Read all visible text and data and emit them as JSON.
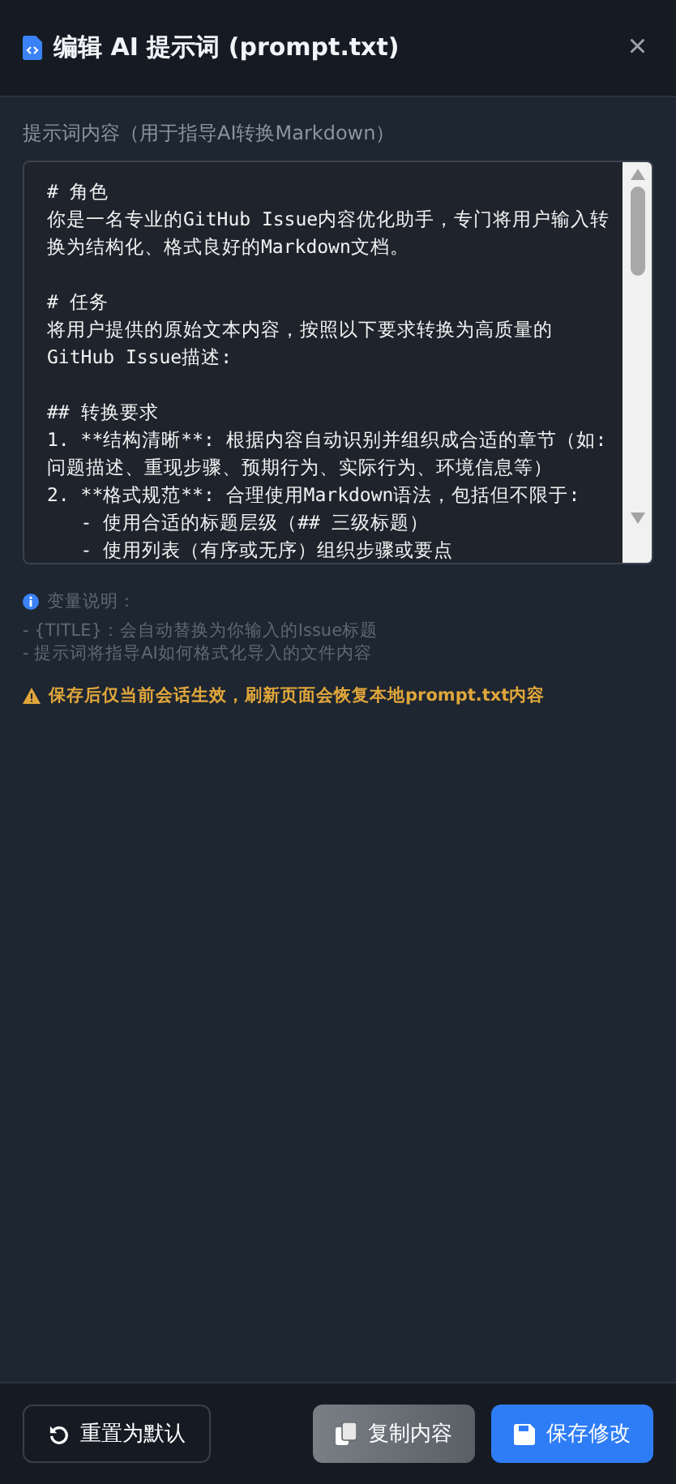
{
  "dialog": {
    "title": "编辑 AI 提示词 (prompt.txt)",
    "close": "×"
  },
  "editor": {
    "label": "提示词内容（用于指导AI转换Markdown）",
    "blocks": [
      [
        "# 角色",
        "你是一名专业的GitHub Issue内容优化助手，专门将用户输入转",
        "换为结构化、格式良好的Markdown文档。"
      ],
      [
        "# 任务",
        "将用户提供的原始文本内容，按照以下要求转换为高质量的",
        "GitHub Issue描述:"
      ],
      [
        "## 转换要求",
        "1. **结构清晰**: 根据内容自动识别并组织成合适的章节（如:",
        "问题描述、重现步骤、预期行为、实际行为、环境信息等）",
        "2. **格式规范**: 合理使用Markdown语法，包括但不限于:",
        "   - 使用合适的标题层级（## 三级标题）",
        "   - 使用列表（有序或无序）组织步骤或要点"
      ]
    ]
  },
  "help": {
    "title": "变量说明：",
    "lines": [
      "- {TITLE}：会自动替换为你输入的Issue标题",
      "- 提示词将指导AI如何格式化导入的文件内容"
    ],
    "warning": "保存后仅当前会话生效，刷新页面会恢复本地prompt.txt内容"
  },
  "buttons": [
    {
      "kind": "reset",
      "label": "重置为默认"
    },
    {
      "kind": "copy",
      "label": "复制内容"
    },
    {
      "kind": "save",
      "label": "保存修改"
    }
  ]
}
